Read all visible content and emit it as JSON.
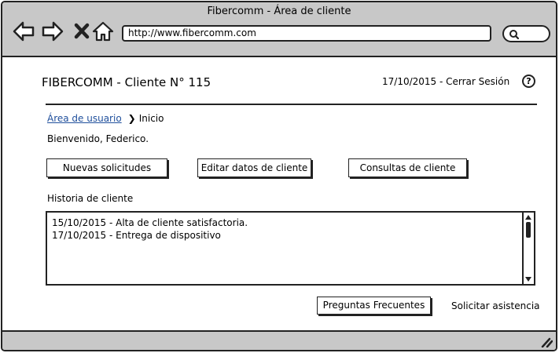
{
  "window": {
    "title": "Fibercomm - Área de cliente"
  },
  "browser": {
    "url": "http://www.fibercomm.com",
    "icons": [
      "back-arrow-icon",
      "forward-arrow-icon",
      "close-x-icon",
      "home-icon",
      "search-icon"
    ]
  },
  "header": {
    "app_title": "FIBERCOMM - Cliente N° 115",
    "date_logout": "17/10/2015 - Cerrar Sesión",
    "help_symbol": "?"
  },
  "breadcrumb": {
    "link": "Área de usuario",
    "current": "Inicio"
  },
  "welcome": "Bienvenido, Federico.",
  "actions": {
    "new_requests": "Nuevas solicitudes",
    "edit_client": "Editar datos de cliente",
    "client_queries": "Consultas de cliente"
  },
  "history": {
    "label": "Historia de cliente",
    "entries": [
      "15/10/2015 - Alta de cliente satisfactoria.",
      "17/10/2015 - Entrega de dispositivo"
    ]
  },
  "footer": {
    "faq": "Preguntas Frecuentes",
    "assistance": "Solicitar asistencia"
  }
}
